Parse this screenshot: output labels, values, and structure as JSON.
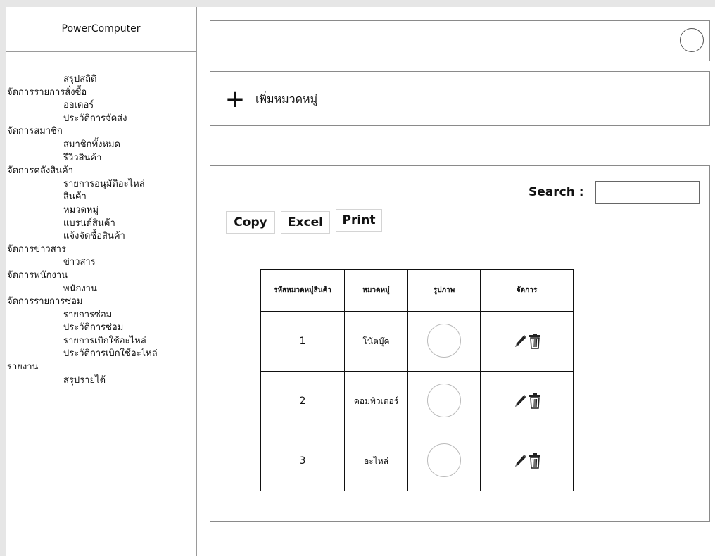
{
  "app": {
    "brand": "PowerComputer"
  },
  "sidebar": {
    "items": [
      {
        "label": "สรุปสถิติ",
        "type": "child"
      },
      {
        "label": "จัดการรายการสั่งซื้อ",
        "type": "group"
      },
      {
        "label": "ออเดอร์",
        "type": "child"
      },
      {
        "label": "ประวัติการจัดส่ง",
        "type": "child"
      },
      {
        "label": "จัดการสมาชิก",
        "type": "group"
      },
      {
        "label": "สมาชิกทั้งหมด",
        "type": "child"
      },
      {
        "label": "รีวิวสินค้า",
        "type": "child"
      },
      {
        "label": "จัดการคลังสินค้า",
        "type": "group"
      },
      {
        "label": "รายการอนุมัติอะไหล่",
        "type": "child"
      },
      {
        "label": "สินค้า",
        "type": "child"
      },
      {
        "label": "หมวดหมู่",
        "type": "child"
      },
      {
        "label": "แบรนด์สินค้า",
        "type": "child"
      },
      {
        "label": "แจ้งจัดซื้อสินค้า",
        "type": "child"
      },
      {
        "label": "จัดการข่าวสาร",
        "type": "group"
      },
      {
        "label": "ข่าวสาร",
        "type": "child"
      },
      {
        "label": "จัดการพนักงาน",
        "type": "group"
      },
      {
        "label": "พนักงาน",
        "type": "child"
      },
      {
        "label": "จัดการรายการซ่อม",
        "type": "group"
      },
      {
        "label": "รายการซ่อม",
        "type": "child"
      },
      {
        "label": "ประวัติการซ่อม",
        "type": "child"
      },
      {
        "label": "รายการเบิกใช้อะไหล่",
        "type": "child"
      },
      {
        "label": "ประวัติการเบิกใช้อะไหล่",
        "type": "child"
      },
      {
        "label": "รายงาน",
        "type": "group"
      },
      {
        "label": "สรุปรายได้",
        "type": "child"
      }
    ]
  },
  "add_category": {
    "icon": "plus-icon",
    "label": "เพิ่มหมวดหมู่"
  },
  "search": {
    "label": "Search :",
    "value": ""
  },
  "export_buttons": {
    "copy": "Copy",
    "excel": "Excel",
    "print": "Print"
  },
  "table": {
    "columns": [
      "รหัสหมวดหมู่สินค้า",
      "หมวดหมู่",
      "รูปภาพ",
      "จัดการ"
    ],
    "rows": [
      {
        "id": "1",
        "category": "โน้ตบุ๊ค"
      },
      {
        "id": "2",
        "category": "คอมพิวเตอร์"
      },
      {
        "id": "3",
        "category": "อะไหล่"
      }
    ],
    "action_icons": [
      "pencil-icon",
      "trash-icon"
    ]
  }
}
